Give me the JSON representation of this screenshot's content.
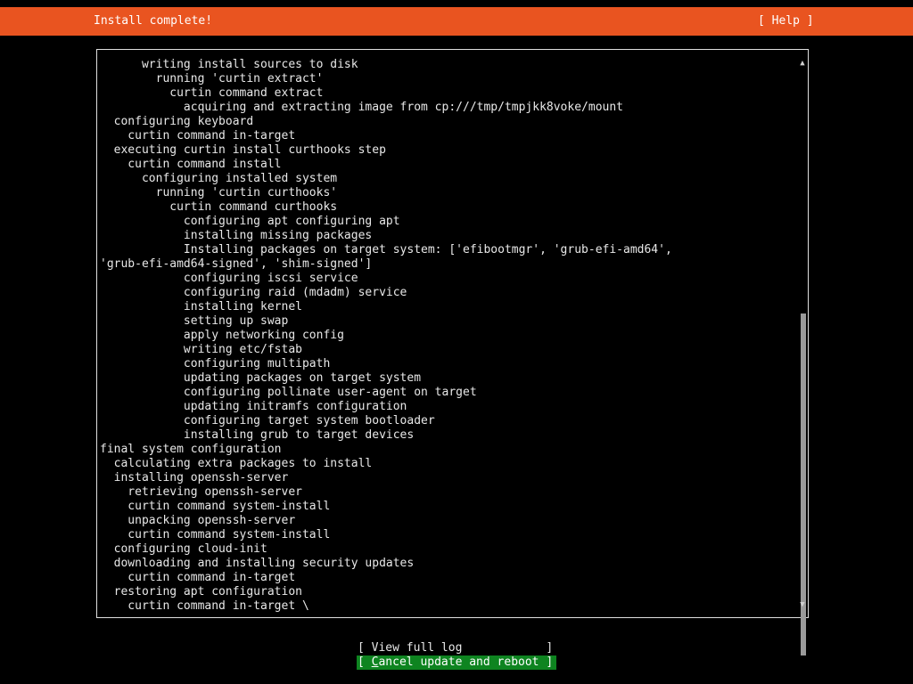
{
  "header": {
    "title": "Install complete!",
    "help_label": "[ Help ]",
    "bg_color": "#e95420"
  },
  "log": {
    "lines": [
      "      writing install sources to disk",
      "        running 'curtin extract'",
      "          curtin command extract",
      "            acquiring and extracting image from cp:///tmp/tmpjkk8voke/mount",
      "  configuring keyboard",
      "    curtin command in-target",
      "  executing curtin install curthooks step",
      "    curtin command install",
      "      configuring installed system",
      "        running 'curtin curthooks'",
      "          curtin command curthooks",
      "            configuring apt configuring apt",
      "            installing missing packages",
      "            Installing packages on target system: ['efibootmgr', 'grub-efi-amd64',",
      "'grub-efi-amd64-signed', 'shim-signed']",
      "            configuring iscsi service",
      "            configuring raid (mdadm) service",
      "            installing kernel",
      "            setting up swap",
      "            apply networking config",
      "            writing etc/fstab",
      "            configuring multipath",
      "            updating packages on target system",
      "            configuring pollinate user-agent on target",
      "            updating initramfs configuration",
      "            configuring target system bootloader",
      "            installing grub to target devices",
      "final system configuration",
      "  calculating extra packages to install",
      "  installing openssh-server",
      "    retrieving openssh-server",
      "    curtin command system-install",
      "    unpacking openssh-server",
      "    curtin command system-install",
      "  configuring cloud-init",
      "  downloading and installing security updates",
      "    curtin command in-target",
      "  restoring apt configuration",
      "    curtin command in-target \\"
    ]
  },
  "scrollbar": {
    "up_glyph": "▲",
    "down_glyph": "▼"
  },
  "actions": {
    "view_log": {
      "prefix": "[ ",
      "label": "View full log",
      "suffix": "            ]"
    },
    "cancel_reboot": {
      "prefix": "[ ",
      "hotkey": "C",
      "label": "ancel update and reboot",
      "suffix": " ]",
      "bg_color": "#0e8420"
    }
  }
}
